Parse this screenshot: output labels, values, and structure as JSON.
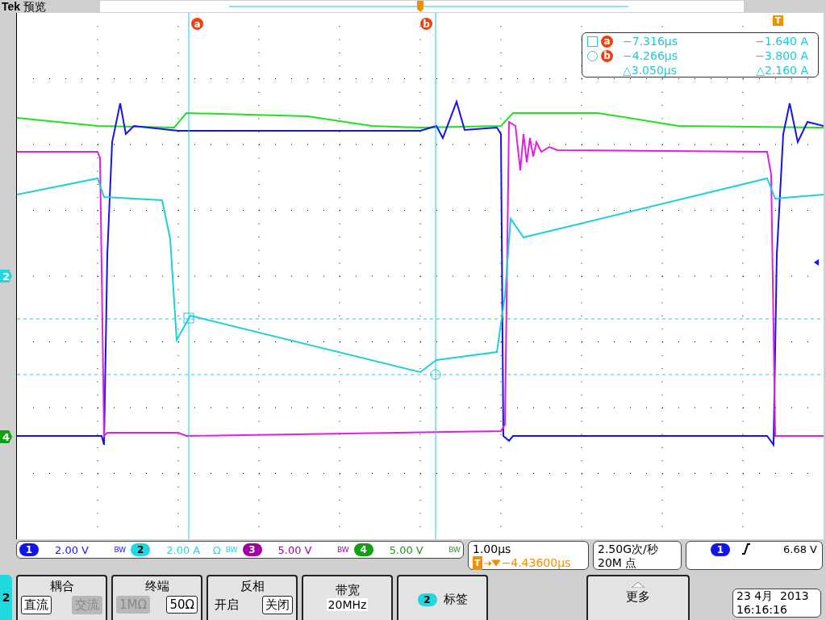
{
  "header": {
    "brand": "Tek",
    "mode": "预览"
  },
  "cursors": [
    {
      "label": "a",
      "kind": "square",
      "readout_label": "a",
      "time": "−7.316µs",
      "value": "−1.640 A"
    },
    {
      "label": "b",
      "kind": "circle",
      "readout_label": "b",
      "time": "−4.266µs",
      "value": "−3.800 A"
    }
  ],
  "cursor_delta": {
    "time": "△3.050µs",
    "value": "△2.160 A"
  },
  "trigger_marker": {
    "label": "T"
  },
  "channel_markers": [
    {
      "label": "2",
      "color": "#20d8e0"
    },
    {
      "label": "4",
      "color": "#10a010"
    }
  ],
  "channels": [
    {
      "number": "1",
      "scale": "2.00 V",
      "bw": "BW",
      "color": "#1414f0"
    },
    {
      "number": "2",
      "scale": "2.00 A",
      "termination": "Ω",
      "bw": "BW",
      "color": "#20d8e0"
    },
    {
      "number": "3",
      "scale": "5.00 V",
      "bw": "BW",
      "color": "#a000a0"
    },
    {
      "number": "4",
      "scale": "5.00 V",
      "bw": "BW",
      "color": "#10a010"
    }
  ],
  "timebase": {
    "scale": "1.00µs",
    "trigger_label": "T",
    "position": "−4.43600µs"
  },
  "acquisition": {
    "rate": "2.50G次/秒",
    "points": "20M 点"
  },
  "trigger": {
    "source": "1",
    "color": "#1414f0",
    "level": "6.68 V"
  },
  "menu": {
    "channel": "2",
    "buttons": [
      {
        "kind": "choice",
        "title": "耦合",
        "options": [
          {
            "label": "直流",
            "selected": true,
            "disabled": false
          },
          {
            "label": "交流",
            "selected": false,
            "disabled": true
          }
        ]
      },
      {
        "kind": "choice",
        "title": "终端",
        "options": [
          {
            "label": "1MΩ",
            "selected": false,
            "disabled": true
          },
          {
            "label": "50Ω",
            "selected": true,
            "disabled": false
          }
        ]
      },
      {
        "kind": "choice",
        "title": "反相",
        "options": [
          {
            "label": "开启",
            "selected": false,
            "disabled": false
          },
          {
            "label": "关闭",
            "selected": true,
            "disabled": false
          }
        ]
      },
      {
        "kind": "value",
        "title": "带宽",
        "value": "20MHz"
      },
      {
        "kind": "badge",
        "badge": "2",
        "title": "标签"
      },
      {
        "kind": "more",
        "title": "更多"
      }
    ]
  },
  "clock": {
    "date": "23 4月  2013",
    "time": "16:16:16"
  }
}
